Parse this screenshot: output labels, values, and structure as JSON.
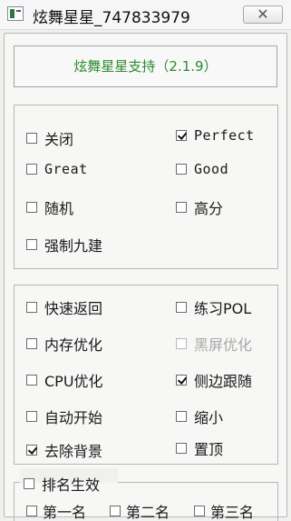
{
  "window": {
    "title": "炫舞星星_747833979",
    "close_glyph": "✕"
  },
  "version": {
    "text": "炫舞星星支持（2.1.9）"
  },
  "group1": {
    "items": [
      {
        "label": "关闭",
        "checked": false
      },
      {
        "label": "Perfect",
        "checked": true
      },
      {
        "label": "Great",
        "checked": false
      },
      {
        "label": "Good",
        "checked": false
      },
      {
        "label": "随机",
        "checked": false
      },
      {
        "label": "高分",
        "checked": false
      },
      {
        "label": "强制九建",
        "checked": false
      }
    ]
  },
  "group2": {
    "items": [
      {
        "label": "快速返回",
        "checked": false
      },
      {
        "label": "练习POL",
        "checked": false
      },
      {
        "label": "内存优化",
        "checked": false
      },
      {
        "label": "黑屏优化",
        "checked": false,
        "disabled": true
      },
      {
        "label": "CPU优化",
        "checked": false
      },
      {
        "label": "侧边跟随",
        "checked": true
      },
      {
        "label": "自动开始",
        "checked": false
      },
      {
        "label": "缩小",
        "checked": false
      },
      {
        "label": "去除背景",
        "checked": true
      },
      {
        "label": "置顶",
        "checked": false
      }
    ]
  },
  "ranking": {
    "title": {
      "label": "排名生效",
      "checked": false
    },
    "items": [
      {
        "label": "第一名",
        "checked": false
      },
      {
        "label": "第二名",
        "checked": false
      },
      {
        "label": "第三名",
        "checked": false
      }
    ]
  },
  "icons": {
    "app": "app-icon",
    "close": "close-icon"
  }
}
